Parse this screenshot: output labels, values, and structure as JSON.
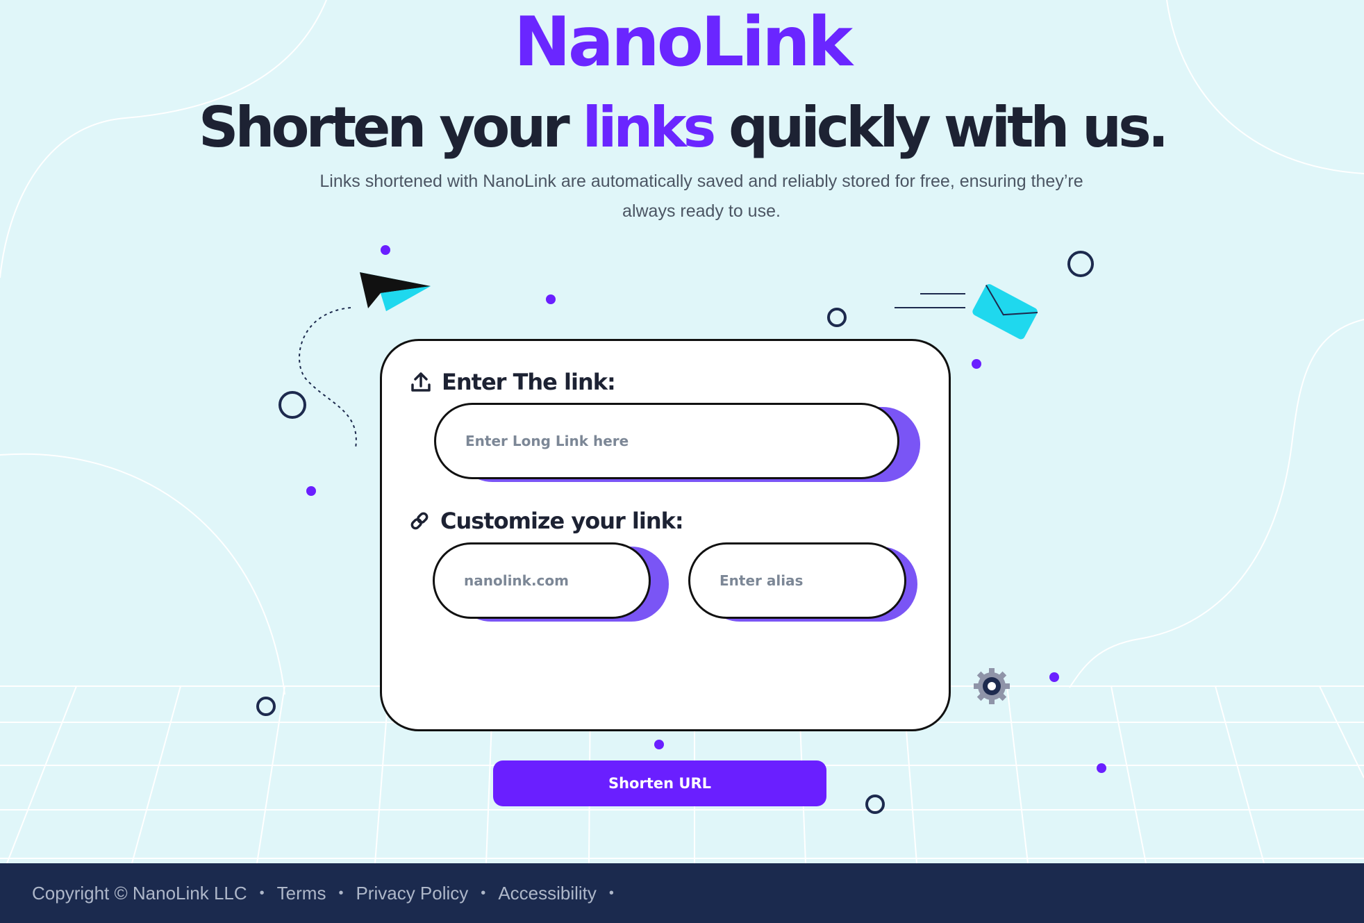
{
  "logo": {
    "part1": "Nano",
    "part2": "Link"
  },
  "headline": {
    "before": "Shorten your ",
    "highlight": "links",
    "after": " quickly with us."
  },
  "subtext": "Links shortened with NanoLink are automatically saved and reliably stored for free, ensuring they’re always ready to use.",
  "form": {
    "link_label": "Enter The link:",
    "link_placeholder": "Enter Long Link here",
    "customize_label": "Customize your link:",
    "domain_placeholder": "nanolink.com",
    "alias_placeholder": "Enter alias",
    "submit_label": "Shorten URL"
  },
  "footer": {
    "copyright": "Copyright © NanoLink LLC",
    "links": [
      "Terms",
      "Privacy Policy",
      "Accessibility"
    ],
    "separator": "•"
  },
  "colors": {
    "accent": "#6a26ff",
    "shadow": "#7a55f5",
    "cyan": "#1fd8ee",
    "footer_bg": "#1b2a4e",
    "bg": "#e0f6f9"
  }
}
